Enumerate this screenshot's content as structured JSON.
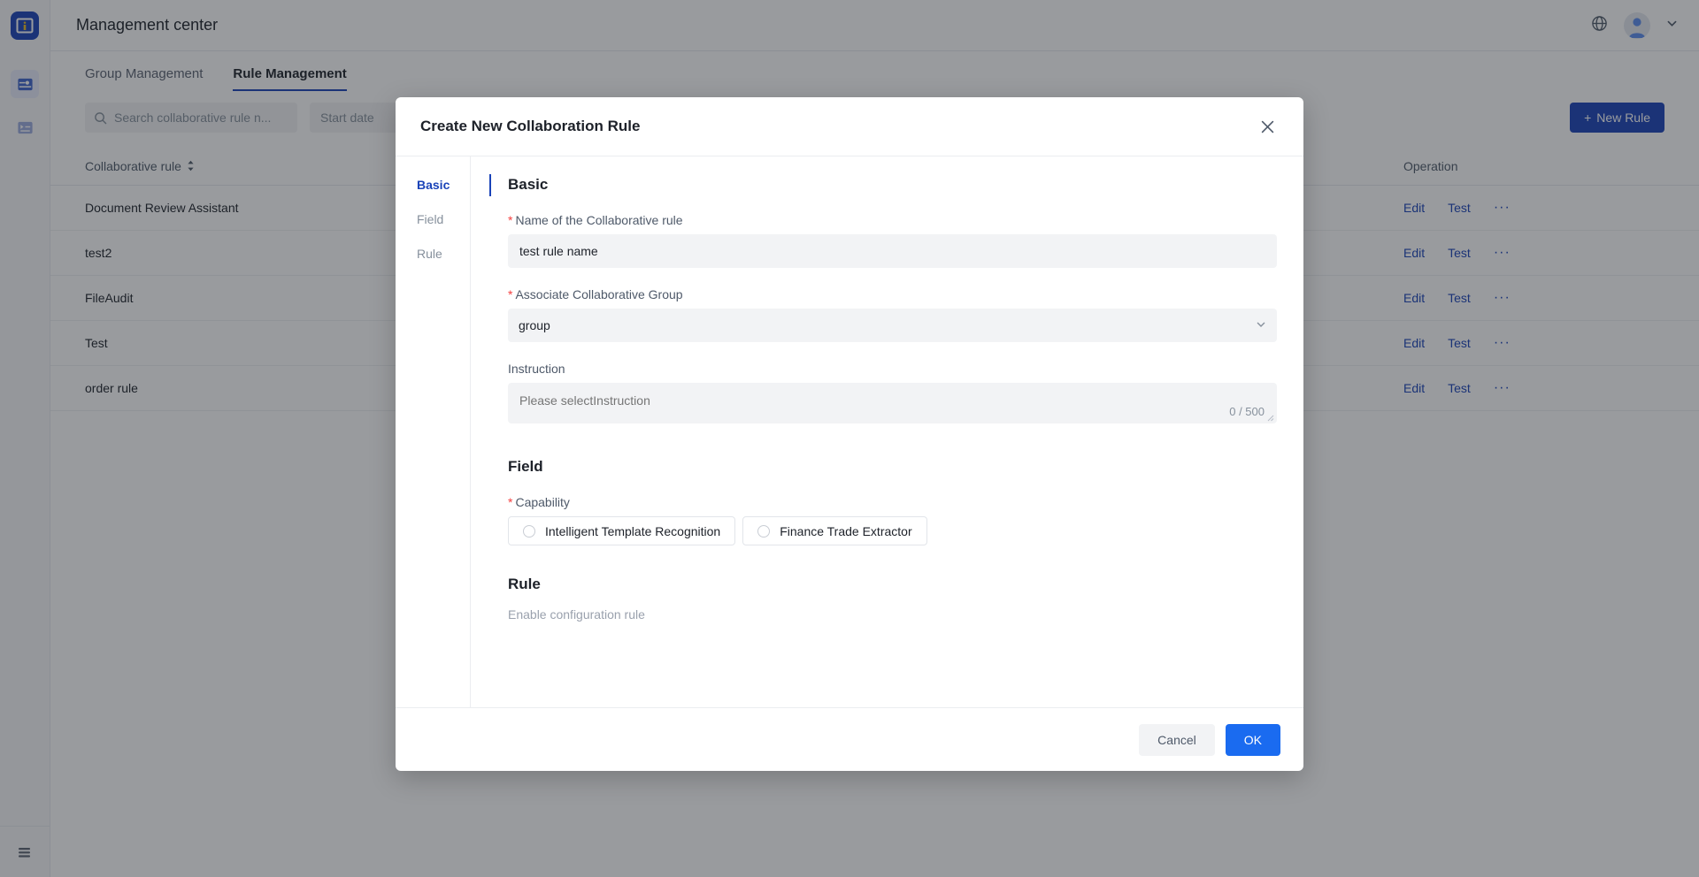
{
  "app": {
    "logo_icon": "app-logo-icon",
    "header": {
      "title": "Management center",
      "globe_icon": "globe-icon",
      "avatar_icon": "avatar-icon",
      "chevron_icon": "chevron-down-icon"
    },
    "rail_items": [
      {
        "icon": "sliders-card-icon",
        "active": true
      },
      {
        "icon": "list-card-icon",
        "active": false
      }
    ],
    "rail_bottom": {
      "icon": "collapse-menu-icon"
    },
    "tabs": [
      {
        "label": "Group Management",
        "active": false
      },
      {
        "label": "Rule Management",
        "active": true
      }
    ],
    "toolbar": {
      "search_placeholder": "Search collaborative rule n...",
      "search_value": "",
      "search_icon": "search-icon",
      "start_date_placeholder": "Start date",
      "new_rule_label": "New Rule",
      "plus_icon": "plus-icon"
    },
    "table": {
      "columns": [
        "Collaborative rule",
        "Operation"
      ],
      "sort_icon": "sort-updown-icon",
      "rows": [
        {
          "rule": "Document Review Assistant"
        },
        {
          "rule": "test2"
        },
        {
          "rule": "FileAudit"
        },
        {
          "rule": "Test"
        },
        {
          "rule": "order rule"
        }
      ],
      "operations": {
        "edit": "Edit",
        "test": "Test",
        "more": "···"
      }
    }
  },
  "modal": {
    "title": "Create New Collaboration Rule",
    "close_icon": "close-icon",
    "steps": [
      {
        "label": "Basic",
        "active": true
      },
      {
        "label": "Field",
        "active": false
      },
      {
        "label": "Rule",
        "active": false
      }
    ],
    "basic": {
      "section_title": "Basic",
      "name_label": "Name of the Collaborative rule",
      "name_value": "test rule name",
      "name_required": "*",
      "group_label": "Associate Collaborative Group",
      "group_value": "group",
      "group_required": "*",
      "group_chevron_icon": "chevron-down-icon",
      "instruction_label": "Instruction",
      "instruction_placeholder": "Please selectInstruction",
      "instruction_value": "",
      "instruction_counter": "0 / 500",
      "resize_grip_icon": "resize-grip-icon"
    },
    "field": {
      "section_title": "Field",
      "capability_label": "Capability",
      "capability_required": "*",
      "options": [
        {
          "label": "Intelligent Template Recognition",
          "selected": false
        },
        {
          "label": "Finance Trade Extractor",
          "selected": false
        }
      ]
    },
    "rule": {
      "section_title": "Rule",
      "note": "Enable configuration rule"
    },
    "footer": {
      "cancel_label": "Cancel",
      "ok_label": "OK"
    }
  },
  "colors": {
    "brand": "#1a43b8",
    "primary_button": "#1a6bf0",
    "required": "#f53f3f",
    "link": "#1a43b8",
    "field_bg": "#f2f3f5"
  }
}
